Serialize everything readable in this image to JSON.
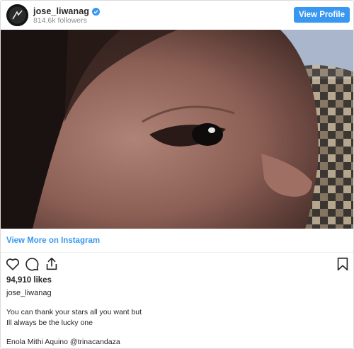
{
  "header": {
    "username": "jose_liwanag",
    "followers": "814.6k followers",
    "view_profile_label": "View Profile"
  },
  "post": {
    "view_more_label": "View More on Instagram",
    "likes": "94,910 likes",
    "caption_username": "jose_liwanag",
    "caption_line1": "You can thank your stars all you want but",
    "caption_line2": "Ill always be the lucky one",
    "caption_line3_text": "Enola Mithi Aquino ",
    "caption_mention": "@trinacandaza"
  },
  "icons": {
    "verified": "verified-badge-icon",
    "like": "heart-icon",
    "comment": "comment-icon",
    "share": "share-icon",
    "save": "bookmark-icon"
  },
  "colors": {
    "accent": "#3897f0",
    "text": "#262626",
    "muted": "#8e8e8e"
  }
}
